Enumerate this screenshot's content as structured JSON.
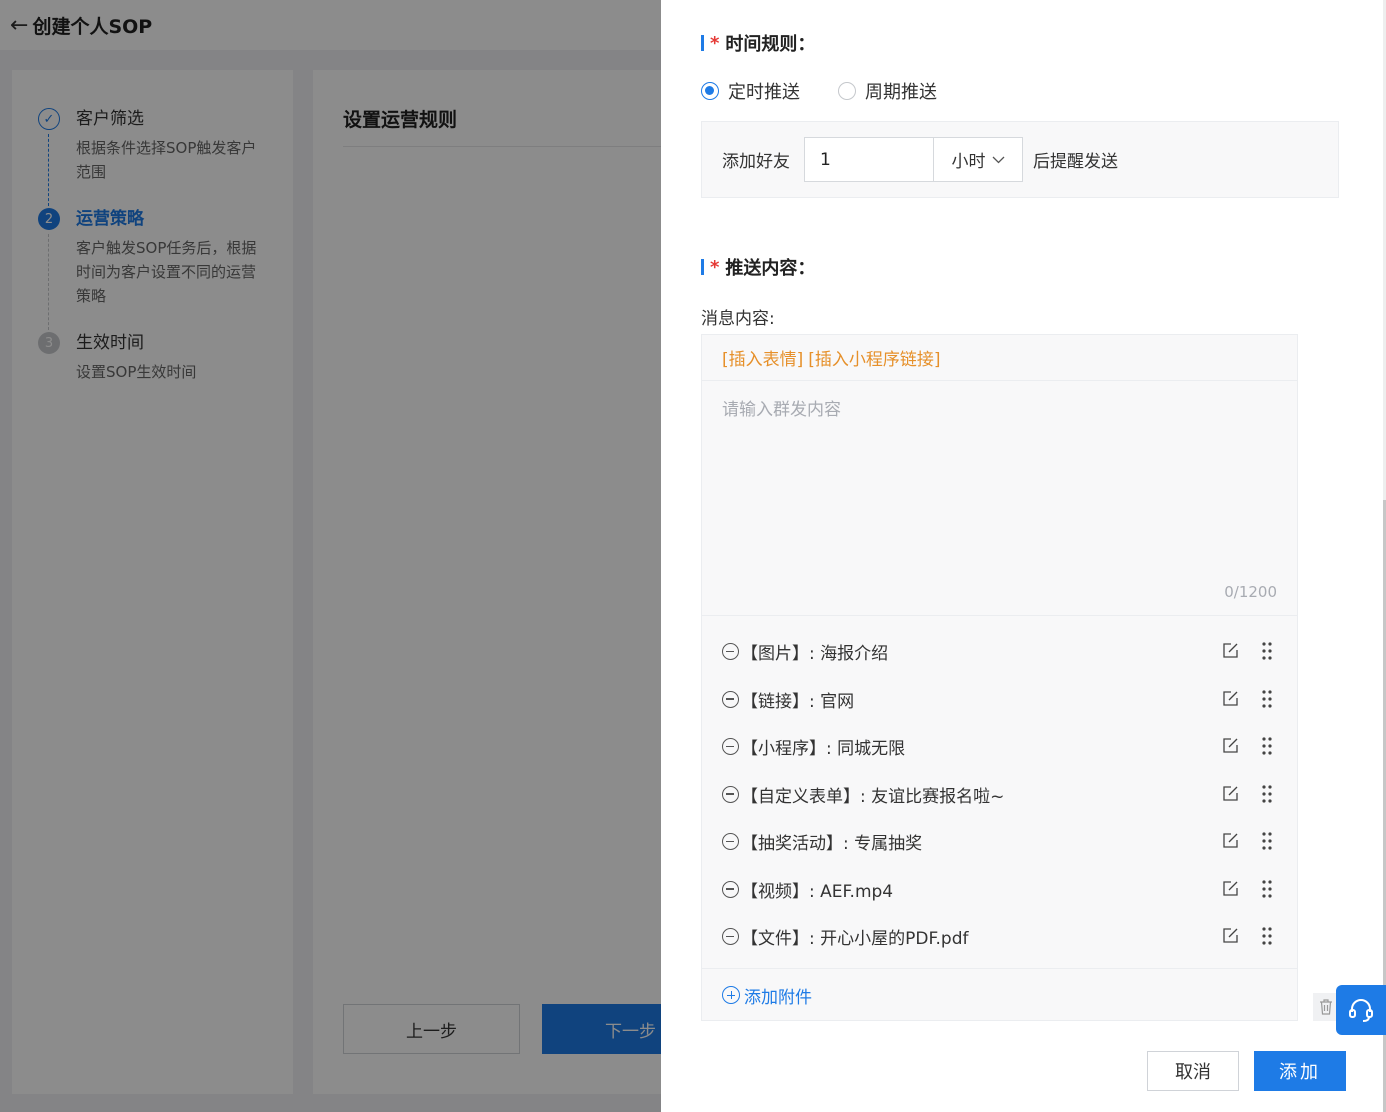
{
  "page": {
    "back_icon": "arrow-left-icon",
    "title": "创建个人SOP",
    "steps": [
      {
        "index": "✓",
        "status": "done",
        "title": "客户筛选",
        "desc": "根据条件选择SOP触发客户范围"
      },
      {
        "index": "2",
        "status": "active",
        "title": "运营策略",
        "desc": "客户触发SOP任务后，根据时间为客户设置不同的运营策略"
      },
      {
        "index": "3",
        "status": "todo",
        "title": "生效时间",
        "desc": "设置SOP生效时间"
      }
    ],
    "main_title": "设置运营规则",
    "prev_label": "上一步",
    "next_label": "下一步"
  },
  "drawer": {
    "time_rule": {
      "title": "时间规则：",
      "required_mark": "*",
      "options": [
        {
          "label": "定时推送",
          "checked": true
        },
        {
          "label": "周期推送",
          "checked": false
        }
      ],
      "prefix": "添加好友",
      "value": "1",
      "unit": "小时",
      "suffix": "后提醒发送"
    },
    "push_content": {
      "title": "推送内容：",
      "required_mark": "*",
      "message_label": "消息内容:",
      "toolbar": [
        "[插入表情]",
        "[插入小程序链接]"
      ],
      "placeholder": "请输入群发内容",
      "counter": "0/1200",
      "attachments": [
        "【图片】: 海报介绍",
        "【链接】: 官网",
        "【小程序】: 同城无限",
        "【自定义表单】: 友谊比赛报名啦~",
        "【抽奖活动】: 专属抽奖",
        "【视频】: AEF.mp4",
        "【文件】: 开心小屋的PDF.pdf"
      ],
      "add_attachment": "添加附件"
    },
    "cancel_label": "取消",
    "submit_label": "添加"
  },
  "colors": {
    "primary": "#1e7be6",
    "required": "#e53935",
    "toolbar_link": "#e6902a"
  }
}
